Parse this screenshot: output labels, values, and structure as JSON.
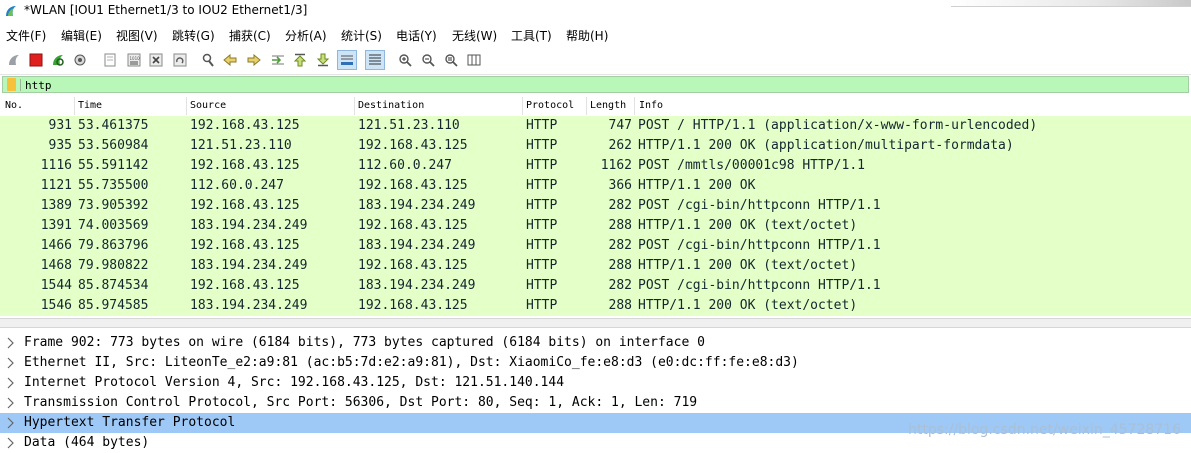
{
  "window": {
    "title": "*WLAN [IOU1 Ethernet1/3 to IOU2 Ethernet1/3]"
  },
  "menu": [
    "文件(F)",
    "编辑(E)",
    "视图(V)",
    "跳转(G)",
    "捕获(C)",
    "分析(A)",
    "统计(S)",
    "电话(Y)",
    "无线(W)",
    "工具(T)",
    "帮助(H)"
  ],
  "toolbar": {
    "buttons": [
      "start-capture-icon",
      "stop-capture-icon",
      "restart-capture-icon",
      "capture-options-icon",
      "open-file-icon",
      "save-file-icon",
      "close-file-icon",
      "reload-file-icon",
      "find-packet-icon",
      "go-back-icon",
      "go-forward-icon",
      "go-to-packet-icon",
      "go-first-packet-icon",
      "go-last-packet-icon",
      "autoscroll-icon",
      "colorize-icon",
      "zoom-in-icon",
      "zoom-out-icon",
      "zoom-reset-icon",
      "resize-columns-icon"
    ]
  },
  "filter": {
    "value": "http",
    "color": "#b8f7b8"
  },
  "packet_list": {
    "columns": [
      "No.",
      "Time",
      "Source",
      "Destination",
      "Protocol",
      "Length",
      "Info"
    ],
    "row_color": "#e4ffc7",
    "rows": [
      {
        "no": "931",
        "time": "53.461375",
        "source": "192.168.43.125",
        "destination": "121.51.23.110",
        "protocol": "HTTP",
        "length": "747",
        "info": "POST / HTTP/1.1  (application/x-www-form-urlencoded)"
      },
      {
        "no": "935",
        "time": "53.560984",
        "source": "121.51.23.110",
        "destination": "192.168.43.125",
        "protocol": "HTTP",
        "length": "262",
        "info": "HTTP/1.1 200 OK  (application/multipart-formdata)"
      },
      {
        "no": "1116",
        "time": "55.591142",
        "source": "192.168.43.125",
        "destination": "112.60.0.247",
        "protocol": "HTTP",
        "length": "1162",
        "info": "POST /mmtls/00001c98 HTTP/1.1"
      },
      {
        "no": "1121",
        "time": "55.735500",
        "source": "112.60.0.247",
        "destination": "192.168.43.125",
        "protocol": "HTTP",
        "length": "366",
        "info": "HTTP/1.1 200 OK"
      },
      {
        "no": "1389",
        "time": "73.905392",
        "source": "192.168.43.125",
        "destination": "183.194.234.249",
        "protocol": "HTTP",
        "length": "282",
        "info": "POST /cgi-bin/httpconn HTTP/1.1"
      },
      {
        "no": "1391",
        "time": "74.003569",
        "source": "183.194.234.249",
        "destination": "192.168.43.125",
        "protocol": "HTTP",
        "length": "288",
        "info": "HTTP/1.1 200 OK  (text/octet)"
      },
      {
        "no": "1466",
        "time": "79.863796",
        "source": "192.168.43.125",
        "destination": "183.194.234.249",
        "protocol": "HTTP",
        "length": "282",
        "info": "POST /cgi-bin/httpconn HTTP/1.1"
      },
      {
        "no": "1468",
        "time": "79.980822",
        "source": "183.194.234.249",
        "destination": "192.168.43.125",
        "protocol": "HTTP",
        "length": "288",
        "info": "HTTP/1.1 200 OK  (text/octet)"
      },
      {
        "no": "1544",
        "time": "85.874534",
        "source": "192.168.43.125",
        "destination": "183.194.234.249",
        "protocol": "HTTP",
        "length": "282",
        "info": "POST /cgi-bin/httpconn HTTP/1.1"
      },
      {
        "no": "1546",
        "time": "85.974585",
        "source": "183.194.234.249",
        "destination": "192.168.43.125",
        "protocol": "HTTP",
        "length": "288",
        "info": "HTTP/1.1 200 OK  (text/octet)"
      }
    ]
  },
  "details": {
    "selected_color": "#9ec8f6",
    "rows": [
      {
        "text": "Frame 902: 773 bytes on wire (6184 bits), 773 bytes captured (6184 bits) on interface 0",
        "selected": false
      },
      {
        "text": "Ethernet II, Src: LiteonTe_e2:a9:81 (ac:b5:7d:e2:a9:81), Dst: XiaomiCo_fe:e8:d3 (e0:dc:ff:fe:e8:d3)",
        "selected": false
      },
      {
        "text": "Internet Protocol Version 4, Src: 192.168.43.125, Dst: 121.51.140.144",
        "selected": false
      },
      {
        "text": "Transmission Control Protocol, Src Port: 56306, Dst Port: 80, Seq: 1, Ack: 1, Len: 719",
        "selected": false
      },
      {
        "text": "Hypertext Transfer Protocol",
        "selected": true
      },
      {
        "text": "Data (464 bytes)",
        "selected": false
      }
    ]
  },
  "watermark": "https://blog.csdn.net/weixin_45728716"
}
